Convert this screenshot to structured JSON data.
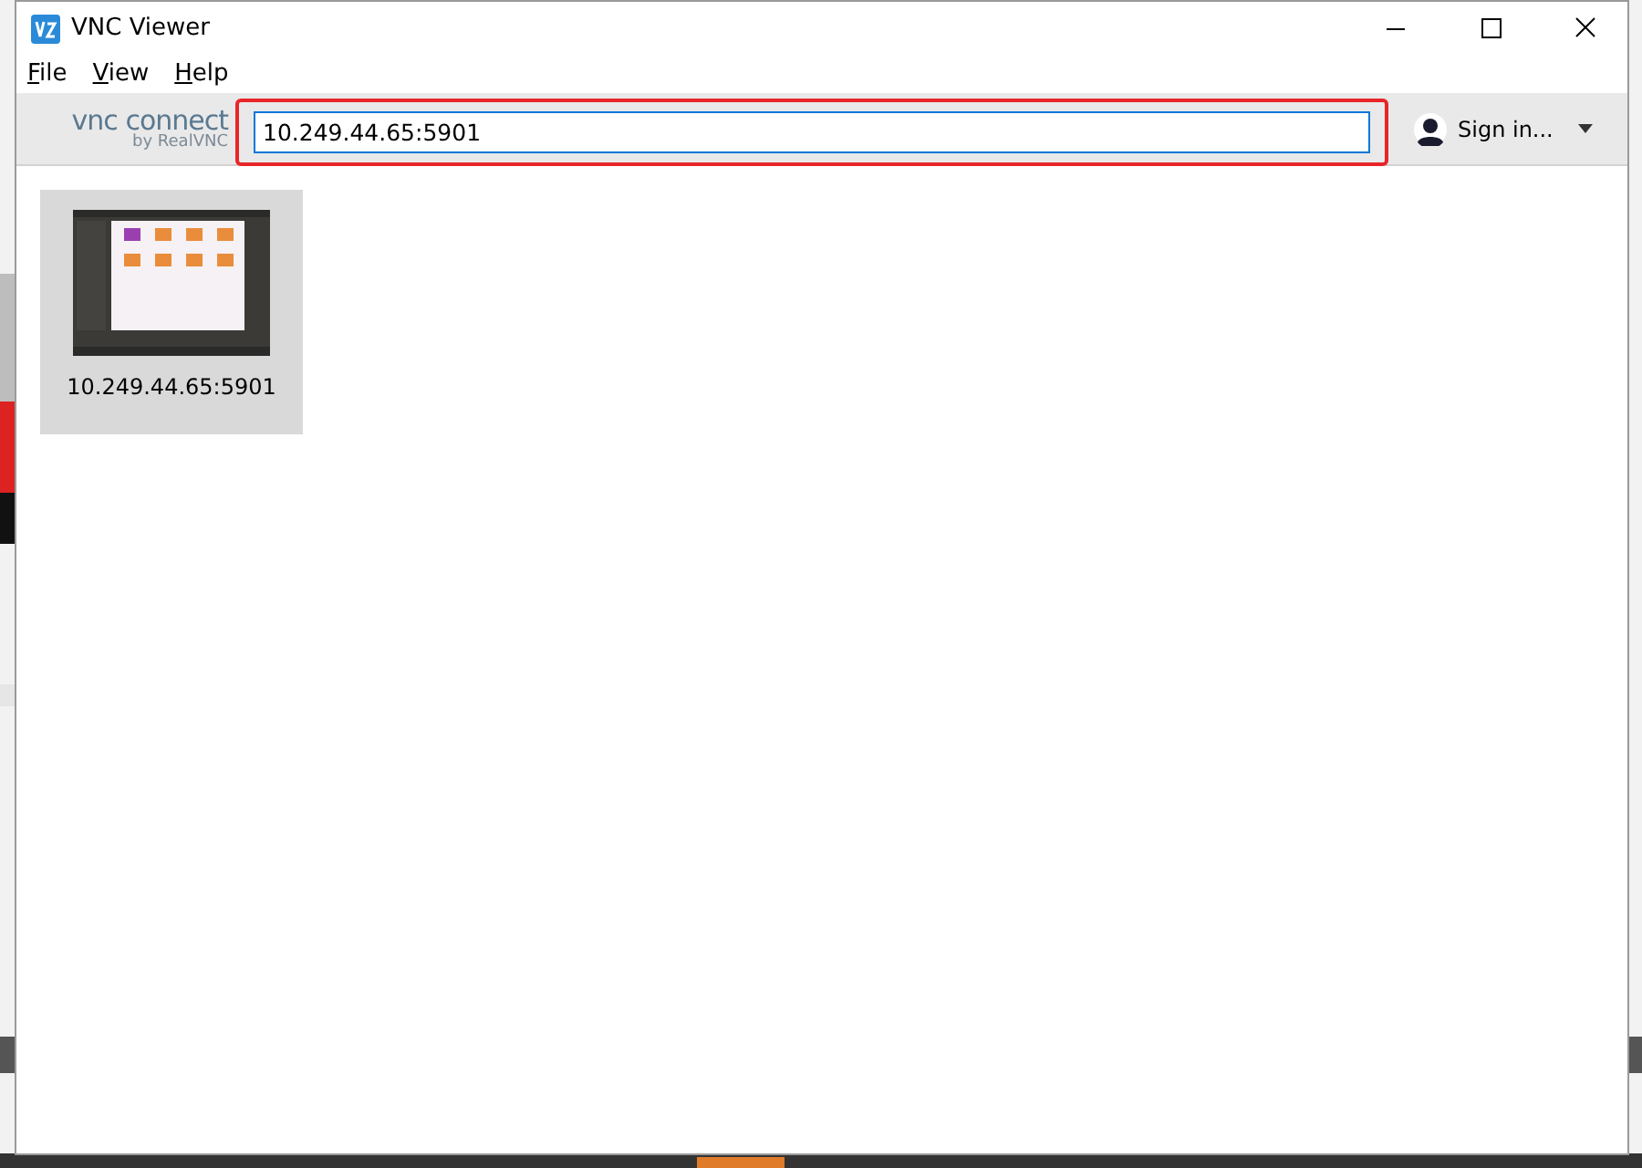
{
  "window": {
    "title": "VNC Viewer"
  },
  "menu": [
    {
      "label": "File"
    },
    {
      "label": "View"
    },
    {
      "label": "Help"
    }
  ],
  "toolbar": {
    "logo": "vnc connect",
    "logo_sub": "by RealVNC",
    "address": "10.249.44.65:5901",
    "highlighted": true,
    "sign_in": "Sign in..."
  },
  "connections": [
    {
      "label": "10.249.44.65:5901",
      "selected": true
    }
  ]
}
